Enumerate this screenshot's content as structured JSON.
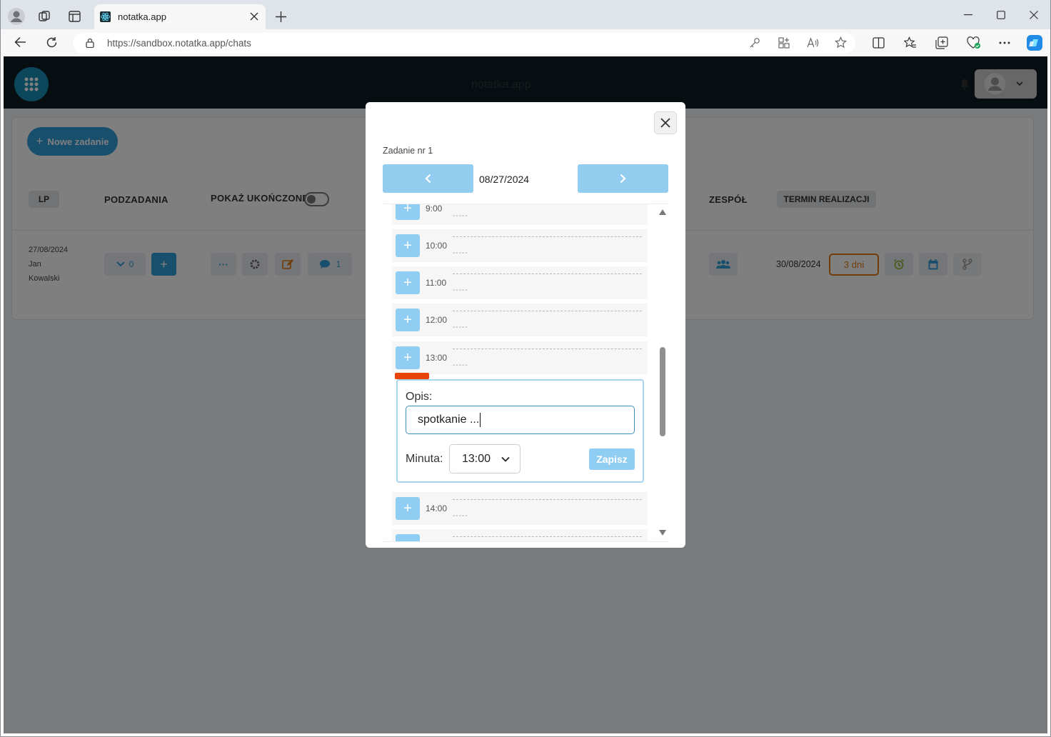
{
  "browser": {
    "tab_title": "notatka.app",
    "url": "https://sandbox.notatka.app/chats"
  },
  "app": {
    "title": "notatka.app",
    "new_task_label": "Nowe zadanie"
  },
  "table": {
    "headers": {
      "lp": "LP",
      "subtasks": "PODZADANIA",
      "show_completed": "POKAŻ UKOŃCZONE",
      "team": "ZESPÓŁ",
      "deadline": "TERMIN REALIZACJI"
    },
    "row": {
      "date": "27/08/2024",
      "first_name": "Jan",
      "last_name": "Kowalski",
      "subtask_count": "0",
      "comment_count": "1",
      "deadline_date": "30/08/2024",
      "days_badge": "3 dni"
    }
  },
  "modal": {
    "task_label": "Zadanie nr 1",
    "date": "08/27/2024",
    "slots": [
      {
        "time": "9:00",
        "dash": "-----"
      },
      {
        "time": "10:00",
        "dash": "-----"
      },
      {
        "time": "11:00",
        "dash": "-----"
      },
      {
        "time": "12:00",
        "dash": "-----"
      },
      {
        "time": "13:00",
        "dash": "-----"
      },
      {
        "time": "14:00",
        "dash": "-----"
      }
    ],
    "form": {
      "opis_label": "Opis:",
      "opis_value": "spotkanie ...",
      "minuta_label": "Minuta:",
      "minuta_value": "13:00",
      "save_label": "Zapisz"
    }
  },
  "colors": {
    "accent": "#2f9fd8",
    "light_accent": "#8fcdf2",
    "header_bg": "#0c1d22",
    "highlight": "#e8440a",
    "badge_orange": "#e07b10"
  }
}
